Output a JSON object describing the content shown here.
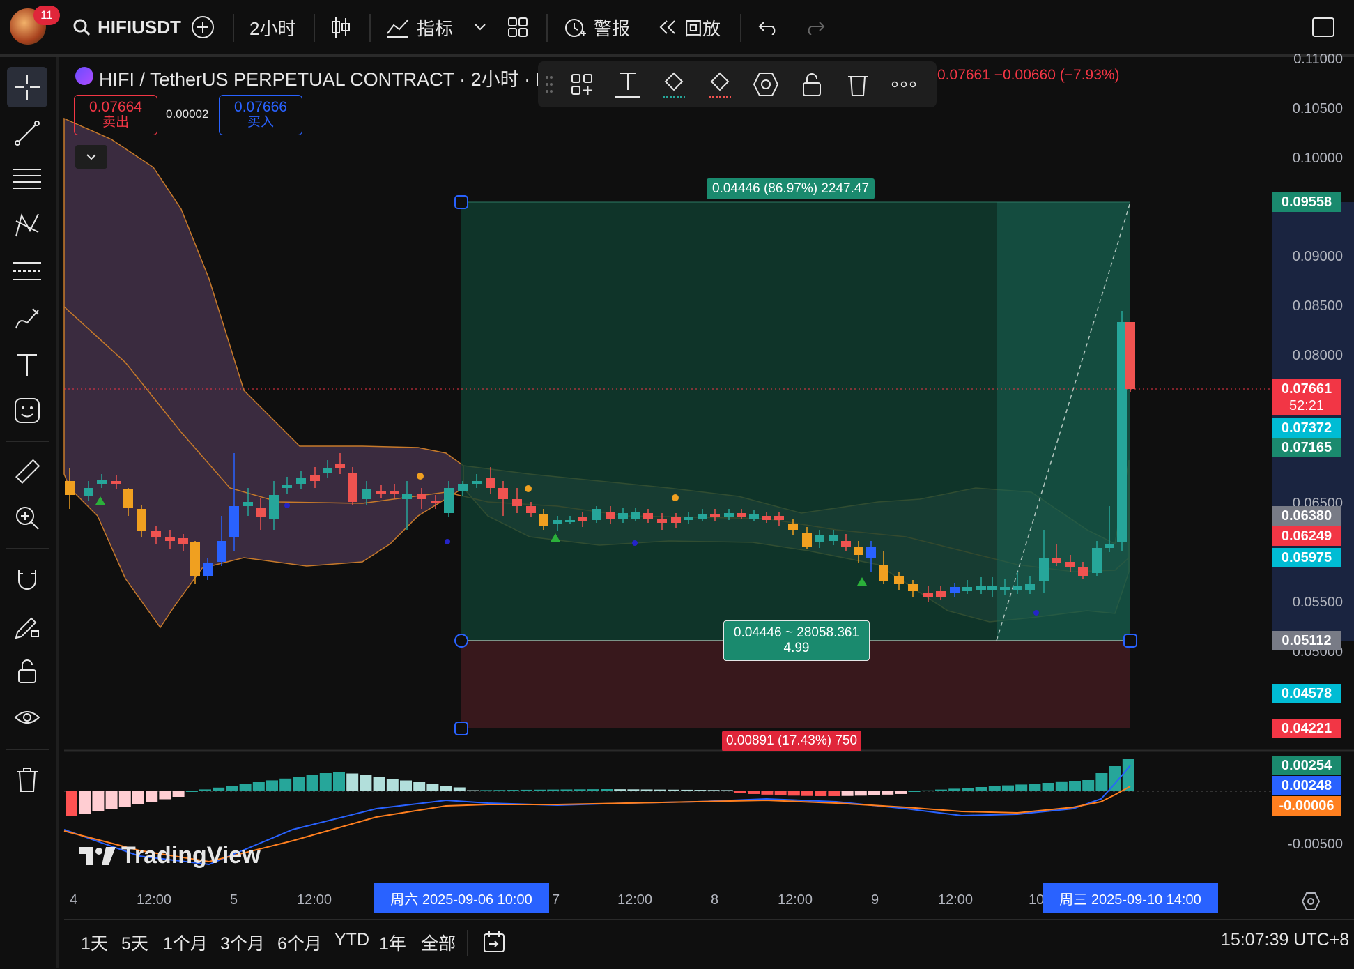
{
  "topbar": {
    "badge_count": "11",
    "symbol": "HIFIUSDT",
    "interval": "2小时",
    "indicators_label": "指标",
    "alert_label": "警报",
    "replay_label": "回放"
  },
  "header": {
    "title": "HIFI / TetherUS PERPETUAL CONTRACT · 2小时 · Bi",
    "ohlc_change": "0.07661  −0.00660 (−7.93%)",
    "sell_price": "0.07664",
    "sell_label": "卖出",
    "spread": "0.00002",
    "buy_price": "0.07666",
    "buy_label": "买入"
  },
  "price_axis": {
    "ticks": [
      "0.11000",
      "0.10500",
      "0.10000",
      "0.09000",
      "0.08500",
      "0.08000",
      "0.06500",
      "0.05500",
      "0.05000"
    ],
    "macd_ticks": [
      "-0.00500"
    ]
  },
  "price_labels": {
    "target": "0.09558",
    "last_price": "0.07661",
    "countdown": "52:21",
    "upper_band": "0.07372",
    "basis_a": "0.07165",
    "gray_a": "0.06380",
    "red_a": "0.06249",
    "cyan_a": "0.05975",
    "entry": "0.05112",
    "lower_band": "0.04578",
    "stop": "0.04221",
    "macd_hist": "0.00254",
    "macd_line": "0.00248",
    "macd_signal": "-0.00006"
  },
  "position_tool": {
    "target_label": "0.04446 (86.97%) 2247.47",
    "entry_label_line1": "0.04446 ~ 28058.361",
    "entry_label_line2": "4.99",
    "stop_label": "0.00891 (17.43%) 750"
  },
  "time_axis": {
    "labels": [
      "4",
      "12:00",
      "5",
      "12:00",
      "7",
      "12:00",
      "8",
      "12:00",
      "9",
      "12:00",
      "10"
    ],
    "start_box": "周六 2025-09-06   10:00",
    "end_box": "周三 2025-09-10   14:00"
  },
  "bottom": {
    "ranges": [
      "1天",
      "5天",
      "1个月",
      "3个月",
      "6个月",
      "YTD",
      "1年",
      "全部"
    ],
    "clock": "15:07:39 UTC+8"
  },
  "branding": {
    "watermark": "TradingView"
  },
  "colors": {
    "up": "#26a69a",
    "down": "#ef5350",
    "profit_zone": "#0f3b2e",
    "loss_zone": "#3a1a1c",
    "band_fill": "#4a3a5a",
    "accent": "#2962ff"
  }
}
